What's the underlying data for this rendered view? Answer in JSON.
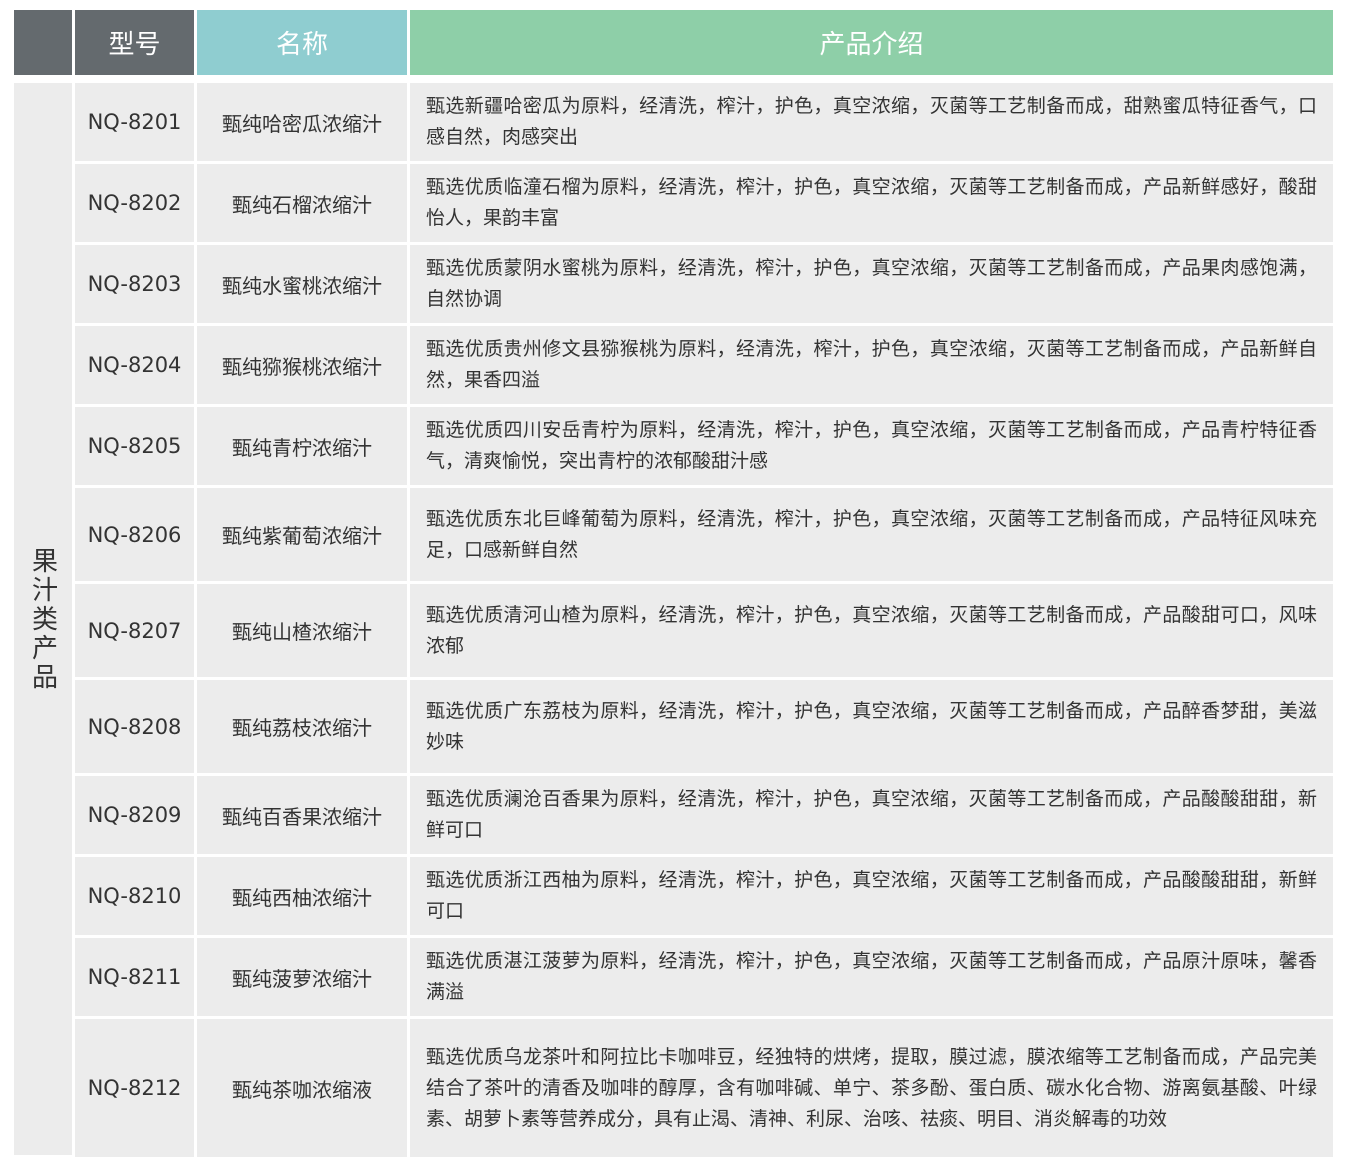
{
  "header": {
    "model": "型号",
    "name": "名称",
    "intro": "产品介绍"
  },
  "category": "果汁类产品",
  "rows": [
    {
      "model": "NQ-8201",
      "name": "甄纯哈密瓜浓缩汁",
      "desc": "甄选新疆哈密瓜为原料，经清洗，榨汁，护色，真空浓缩，灭菌等工艺制备而成，甜熟蜜瓜特征香气，口感自然，肉感突出"
    },
    {
      "model": "NQ-8202",
      "name": "甄纯石榴浓缩汁",
      "desc": "甄选优质临潼石榴为原料，经清洗，榨汁，护色，真空浓缩，灭菌等工艺制备而成，产品新鲜感好，酸甜怡人，果韵丰富"
    },
    {
      "model": "NQ-8203",
      "name": "甄纯水蜜桃浓缩汁",
      "desc": "甄选优质蒙阴水蜜桃为原料，经清洗，榨汁，护色，真空浓缩，灭菌等工艺制备而成，产品果肉感饱满，自然协调"
    },
    {
      "model": "NQ-8204",
      "name": "甄纯猕猴桃浓缩汁",
      "desc": "甄选优质贵州修文县猕猴桃为原料，经清洗，榨汁，护色，真空浓缩，灭菌等工艺制备而成，产品新鲜自然，果香四溢"
    },
    {
      "model": "NQ-8205",
      "name": "甄纯青柠浓缩汁",
      "desc": "甄选优质四川安岳青柠为原料，经清洗，榨汁，护色，真空浓缩，灭菌等工艺制备而成，产品青柠特征香气，清爽愉悦，突出青柠的浓郁酸甜汁感"
    },
    {
      "model": "NQ-8206",
      "name": "甄纯紫葡萄浓缩汁",
      "desc": "甄选优质东北巨峰葡萄为原料，经清洗，榨汁，护色，真空浓缩，灭菌等工艺制备而成，产品特征风味充足，口感新鲜自然"
    },
    {
      "model": "NQ-8207",
      "name": "甄纯山楂浓缩汁",
      "desc": "甄选优质清河山楂为原料，经清洗，榨汁，护色，真空浓缩，灭菌等工艺制备而成，产品酸甜可口，风味浓郁"
    },
    {
      "model": "NQ-8208",
      "name": "甄纯荔枝浓缩汁",
      "desc": "甄选优质广东荔枝为原料，经清洗，榨汁，护色，真空浓缩，灭菌等工艺制备而成，产品醉香梦甜，美滋妙味"
    },
    {
      "model": "NQ-8209",
      "name": "甄纯百香果浓缩汁",
      "desc": "甄选优质澜沧百香果为原料，经清洗，榨汁，护色，真空浓缩，灭菌等工艺制备而成，产品酸酸甜甜，新鲜可口"
    },
    {
      "model": "NQ-8210",
      "name": "甄纯西柚浓缩汁",
      "desc": "甄选优质浙江西柚为原料，经清洗，榨汁，护色，真空浓缩，灭菌等工艺制备而成，产品酸酸甜甜，新鲜可口"
    },
    {
      "model": "NQ-8211",
      "name": "甄纯菠萝浓缩汁",
      "desc": "甄选优质湛江菠萝为原料，经清洗，榨汁，护色，真空浓缩，灭菌等工艺制备而成，产品原汁原味，馨香满溢"
    },
    {
      "model": "NQ-8212",
      "name": "甄纯茶咖浓缩液",
      "desc": "甄选优质乌龙茶叶和阿拉比卡咖啡豆，经独特的烘烤，提取，膜过滤，膜浓缩等工艺制备而成，产品完美结合了茶叶的清香及咖啡的醇厚，含有咖啡碱、单宁、茶多酚、蛋白质、碳水化合物、游离氨基酸、叶绿素、胡萝卜素等营养成分，具有止渴、清神、利尿、治咳、祛痰、明目、消炎解毒的功效"
    }
  ]
}
